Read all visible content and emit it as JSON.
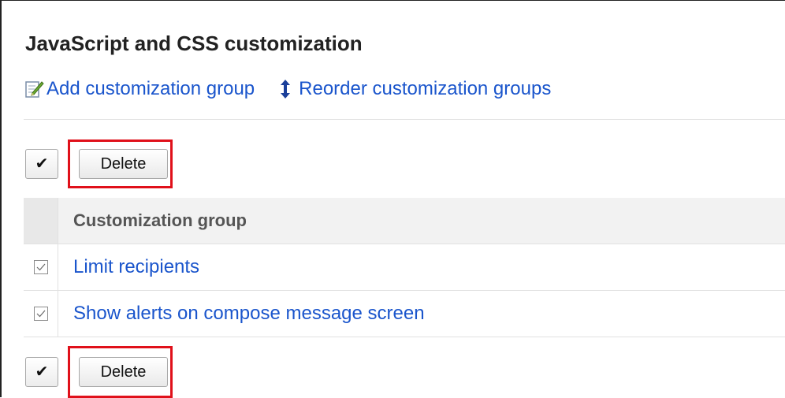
{
  "page": {
    "title": "JavaScript and CSS customization"
  },
  "menu": {
    "add_label": "Add customization group",
    "reorder_label": "Reorder customization groups"
  },
  "toolbar": {
    "check_all_symbol": "✔",
    "delete_label": "Delete"
  },
  "table": {
    "header": "Customization group",
    "rows": [
      {
        "name": "Limit recipients",
        "checked": true
      },
      {
        "name": "Show alerts on compose message screen",
        "checked": true
      }
    ]
  },
  "colors": {
    "link": "#1a55cc",
    "highlight": "#e0101a",
    "header_bg": "#f2f2f2"
  },
  "icons": {
    "add": "edit-pencil-icon",
    "reorder": "vertical-arrows-icon"
  }
}
